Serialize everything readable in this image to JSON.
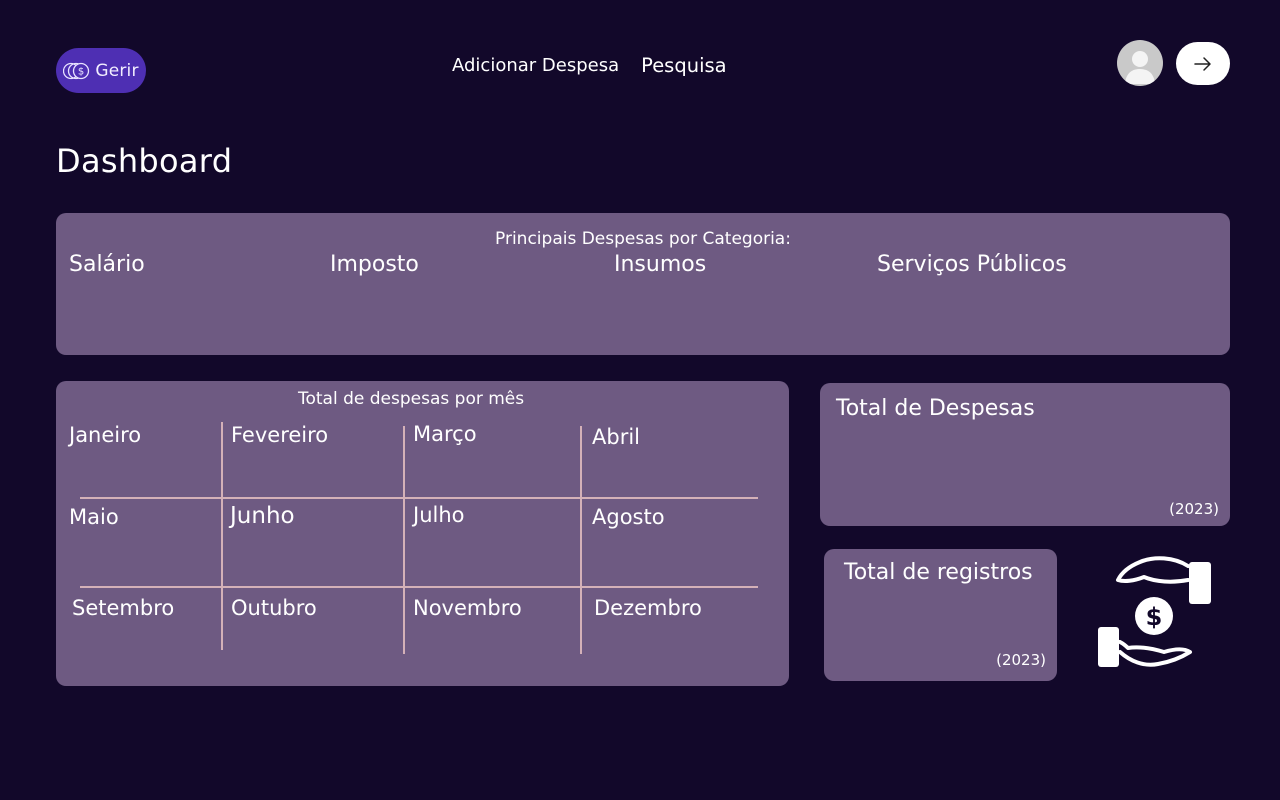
{
  "header": {
    "logo_text": "Gerir",
    "nav": {
      "add_expense": "Adicionar Despesa",
      "search": "Pesquisa"
    }
  },
  "page": {
    "title": "Dashboard"
  },
  "categories_card": {
    "title": "Principais Despesas por Categoria:",
    "items": [
      "Salário",
      "Imposto",
      "Insumos",
      "Serviços Públicos"
    ]
  },
  "months_card": {
    "title": "Total de despesas por mês",
    "months": [
      "Janeiro",
      "Fevereiro",
      "Março",
      "Abril",
      "Maio",
      "Junho",
      "Julho",
      "Agosto",
      "Setembro",
      "Outubro",
      "Novembro",
      "Dezembro"
    ]
  },
  "total_expenses_card": {
    "title": "Total de Despesas",
    "year": "(2023)"
  },
  "total_records_card": {
    "title": "Total de registros",
    "year": "(2023)"
  },
  "icons": [
    "coin-icon",
    "avatar",
    "arrow-right-icon",
    "money-hands-icon"
  ],
  "colors": {
    "background": "#12082a",
    "card": "#6e5a82",
    "logo_bg": "#4e2fb3",
    "grid_line": "#d4b1b8"
  }
}
